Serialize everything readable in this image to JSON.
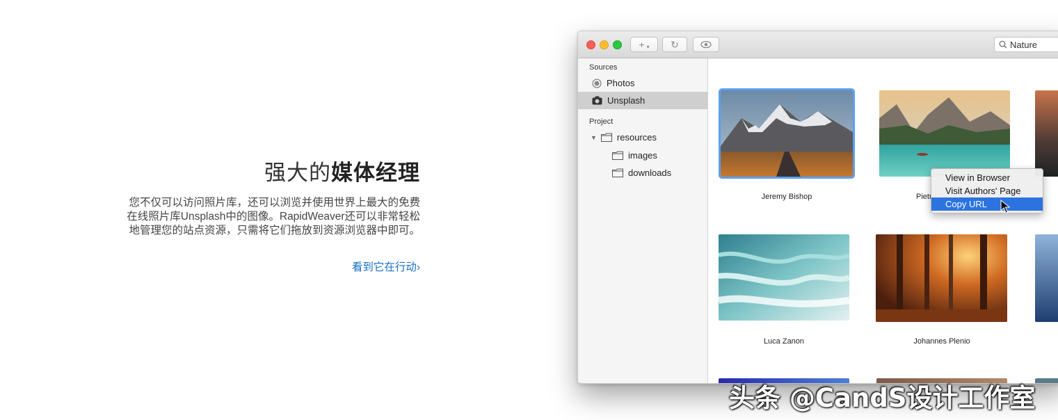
{
  "hero": {
    "title_light": "强大的",
    "title_bold": "媒体经理",
    "para_lines": [
      "您不仅可以访问照片库，还可以浏览并使用世界上最大的免费",
      "在线照片库Unsplash中的图像。RapidWeaver还可以非常轻松",
      "地管理您的站点资源，只需将它们拖放到资源浏览器中即可。"
    ],
    "link": "看到它在行动›"
  },
  "window": {
    "toolbar": {
      "add": "+",
      "refresh": "↻",
      "preview": "◉"
    },
    "search": {
      "value": "Nature"
    },
    "sidebar": {
      "sources_header": "Sources",
      "sources": [
        {
          "label": "Photos",
          "icon": "radio-icon"
        },
        {
          "label": "Unsplash",
          "icon": "camera-icon",
          "selected": true
        }
      ],
      "project_header": "Project",
      "project": [
        {
          "label": "resources",
          "icon": "folder-icon",
          "expanded": true
        },
        {
          "label": "images",
          "icon": "folder-icon"
        },
        {
          "label": "downloads",
          "icon": "folder-icon"
        }
      ]
    },
    "photos": [
      {
        "author": "Jeremy Bishop",
        "selected": true
      },
      {
        "author": "Pietro De Grandi"
      },
      {
        "author": "Luca Zanon"
      },
      {
        "author": "Johannes Plenio"
      }
    ],
    "context_menu": [
      {
        "label": "View in Browser"
      },
      {
        "label": "Visit Authors' Page"
      },
      {
        "label": "Copy URL",
        "highlighted": true
      }
    ]
  },
  "watermark": "头条 @CandS设计工作室",
  "colors": {
    "accent": "#2c73e0",
    "link": "#1a6fc4",
    "selection_outline": "#5aa0f0"
  }
}
